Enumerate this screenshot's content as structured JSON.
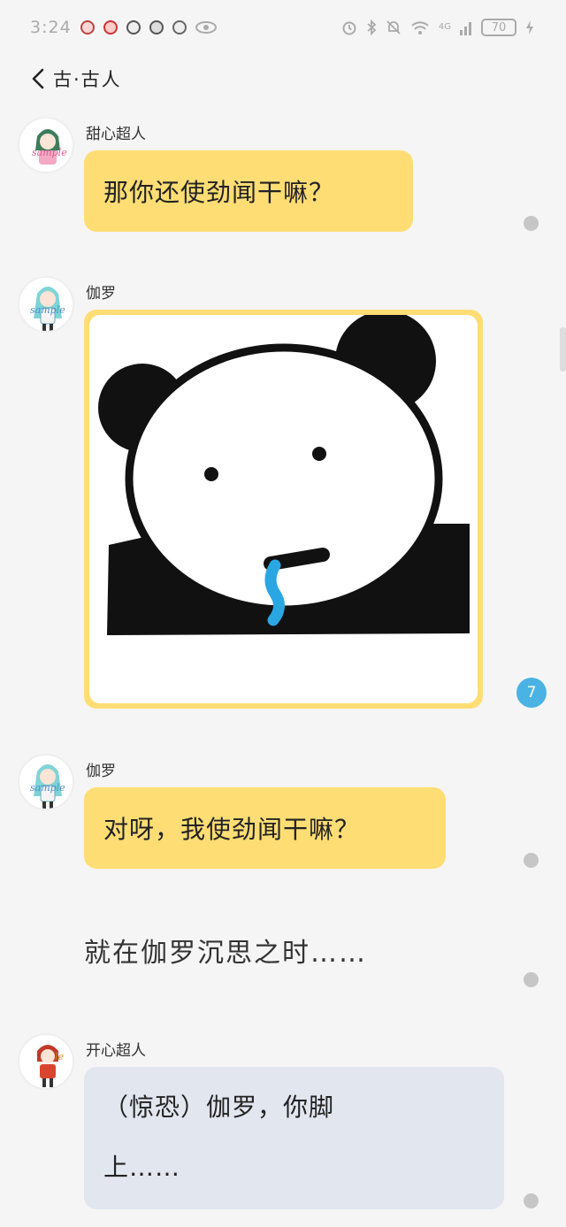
{
  "status_bar": {
    "time": "3:24",
    "network": "4G",
    "battery": "70",
    "notification_icons": [
      "app-notification-icon",
      "app-notification-icon",
      "app-notification-icon",
      "app-notification-icon",
      "app-notification-icon"
    ],
    "right_icons": [
      "alarm-icon",
      "bluetooth-icon",
      "mute-icon",
      "wifi-icon",
      "signal-icon",
      "charging-icon"
    ]
  },
  "header": {
    "back_icon": "chevron-left-icon",
    "title": "古·古人"
  },
  "messages": [
    {
      "sender": "甜心超人",
      "text": "那你还使劲闻干嘛？",
      "status": "dot"
    },
    {
      "sender": "伽罗",
      "type": "sticker",
      "sticker": "panda-drooling-meme",
      "unread_count": "7"
    },
    {
      "sender": "伽罗",
      "text": "对呀，我使劲闻干嘛？",
      "status": "dot"
    },
    {
      "type": "narration",
      "text": "就在伽罗沉思之时……",
      "status": "dot"
    },
    {
      "sender": "开心超人",
      "text_line1": "（惊恐）伽罗，你脚",
      "text_line2": "上……",
      "status": "dot"
    }
  ],
  "colors": {
    "bubble_yellow": "#fedd74",
    "bubble_grey": "#e1e6ef",
    "badge_blue": "#4ab3e4",
    "background": "#f5f5f5"
  }
}
